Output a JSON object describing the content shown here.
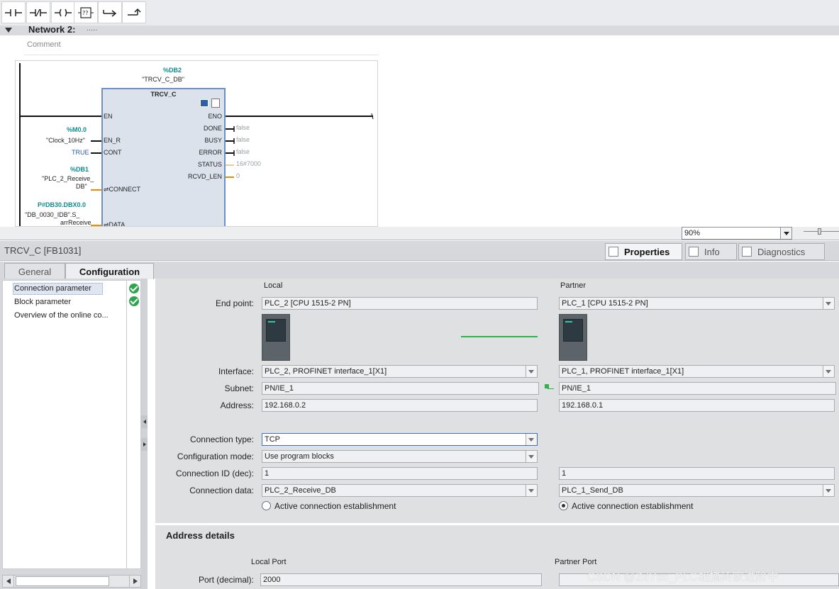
{
  "network": {
    "title": "Network 2:",
    "dots": ".....",
    "comment_label": "Comment"
  },
  "ladder": {
    "instance_db_address": "%DB2",
    "instance_db_name": "\"TRCV_C_DB\"",
    "fb_name": "TRCV_C",
    "inputs": [
      {
        "pin": "EN",
        "address": "",
        "value": ""
      },
      {
        "pin": "EN_R",
        "address": "%M0.0",
        "value": "\"Clock_10Hz\""
      },
      {
        "pin": "CONT",
        "address": "",
        "value": "TRUE"
      },
      {
        "pin": "CONNECT",
        "address": "%DB1",
        "value_lines": [
          "\"PLC_2_Receive_",
          "DB\""
        ]
      },
      {
        "pin": "DATA",
        "address": "P#DB30.DBX0.0",
        "value_lines": [
          "\"DB_0030_IDB\".S_",
          "arrReceive"
        ]
      }
    ],
    "outputs": [
      {
        "pin": "ENO",
        "value": ""
      },
      {
        "pin": "DONE",
        "value": "false"
      },
      {
        "pin": "BUSY",
        "value": "false"
      },
      {
        "pin": "ERROR",
        "value": "false"
      },
      {
        "pin": "STATUS",
        "value": "16#7000"
      },
      {
        "pin": "RCVD_LEN",
        "value": "0"
      }
    ]
  },
  "zoom": {
    "value": "90%"
  },
  "inspector": {
    "block_title": "TRCV_C [FB1031]",
    "tabs": [
      {
        "label": "Properties",
        "icon": "properties-icon",
        "active": true
      },
      {
        "label": "Info",
        "icon": "info-icon",
        "active": false
      },
      {
        "label": "Diagnostics",
        "icon": "diagnostics-icon",
        "active": false
      }
    ],
    "subtabs": [
      {
        "label": "General",
        "active": false
      },
      {
        "label": "Configuration",
        "active": true
      }
    ]
  },
  "nav": {
    "items": [
      {
        "label": "Connection parameter",
        "selected": true,
        "status": "ok"
      },
      {
        "label": "Block parameter",
        "selected": false,
        "status": "ok"
      },
      {
        "label": "Overview of the online co...",
        "selected": false,
        "status": ""
      }
    ]
  },
  "config": {
    "local_header": "Local",
    "partner_header": "Partner",
    "labels": {
      "end_point": "End point:",
      "interface": "Interface:",
      "subnet": "Subnet:",
      "address": "Address:",
      "connection_type": "Connection type:",
      "configuration_mode": "Configuration mode:",
      "connection_id": "Connection ID (dec):",
      "connection_data": "Connection data:"
    },
    "local": {
      "end_point": "PLC_2 [CPU 1515-2 PN]",
      "interface": "PLC_2, PROFINET interface_1[X1]",
      "subnet": "PN/IE_1",
      "address": "192.168.0.2",
      "connection_id": "1",
      "connection_data": "PLC_2_Receive_DB",
      "active_connection": "Active connection establishment",
      "active_selected": false
    },
    "partner": {
      "end_point": "PLC_1 [CPU 1515-2 PN]",
      "interface": "PLC_1, PROFINET interface_1[X1]",
      "subnet": "PN/IE_1",
      "address": "192.168.0.1",
      "connection_id": "1",
      "connection_data": "PLC_1_Send_DB",
      "active_connection": "Active connection establishment",
      "active_selected": true
    },
    "connection_type": "TCP",
    "configuration_mode": "Use program blocks"
  },
  "address_details": {
    "title": "Address details",
    "local_port_header": "Local Port",
    "partner_port_header": "Partner Port",
    "port_label": "Port (decimal):",
    "local_port": "2000",
    "partner_port": ""
  },
  "watermark": "CSDN @ZdYzc_PLC胡搞砖家进阶中",
  "colors": {
    "accent_blue": "#3d6fc8",
    "ok_green": "#2ea44f",
    "teal": "#0f8c8c",
    "link_green": "#2fb24a"
  }
}
